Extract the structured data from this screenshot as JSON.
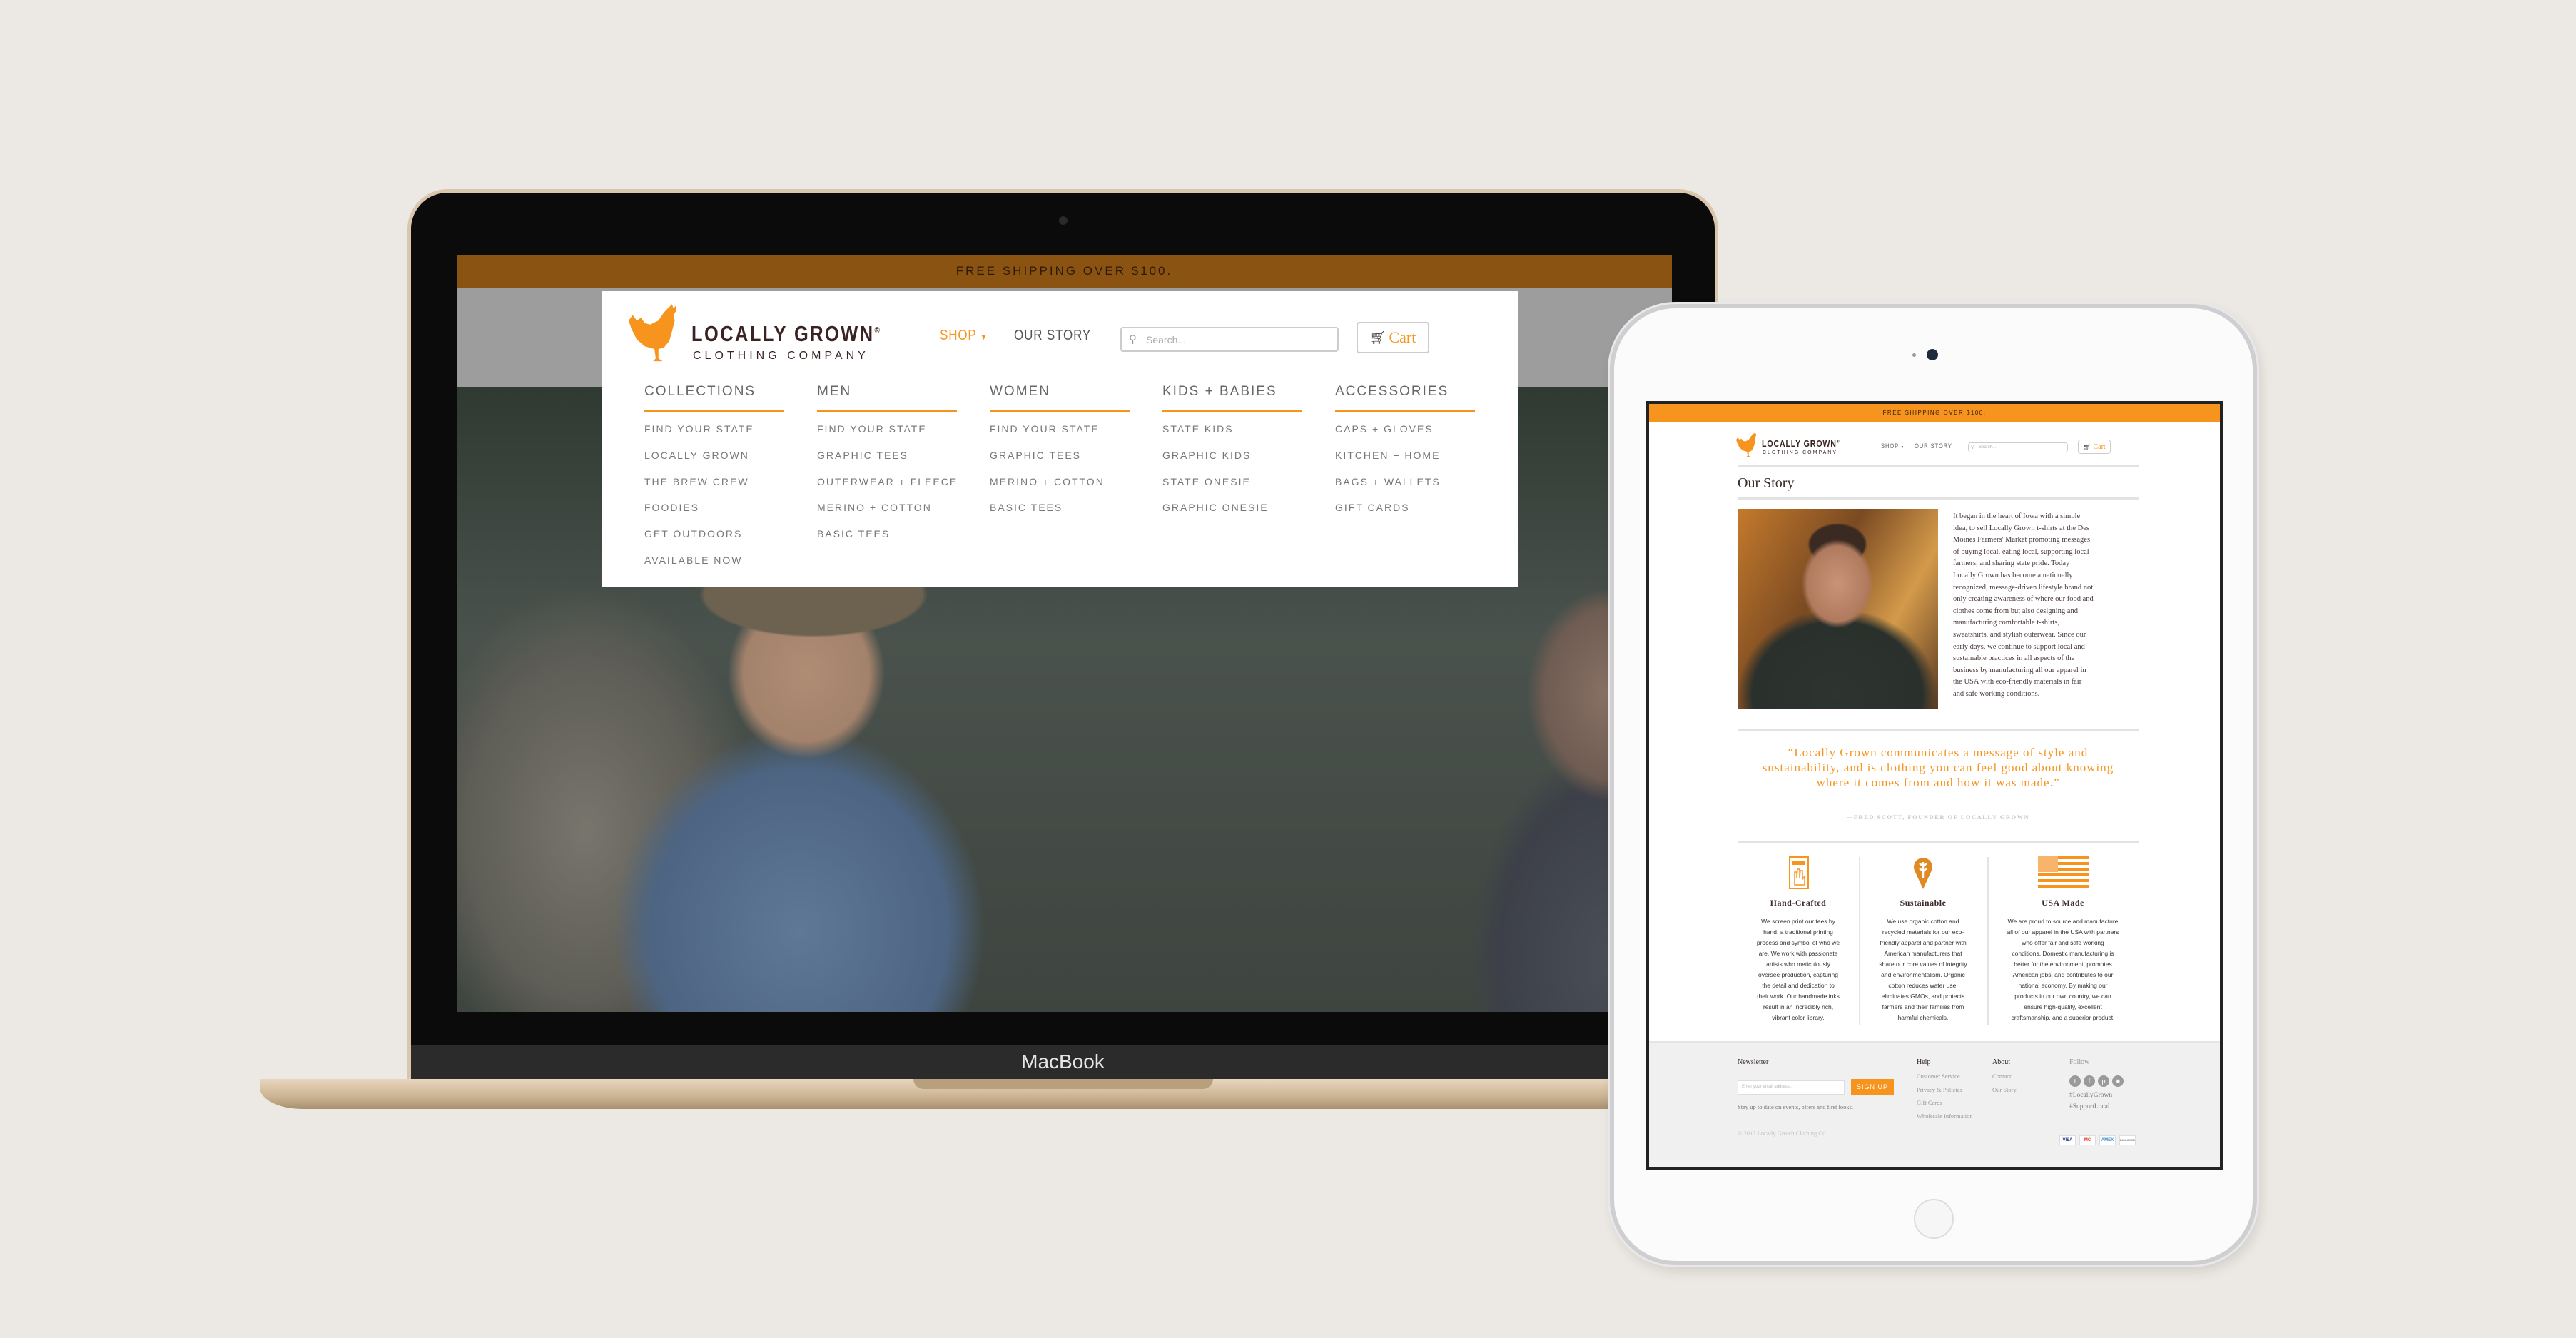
{
  "laptop": {
    "device_label": "MacBook",
    "promo": "FREE SHIPPING OVER $100.",
    "logo": {
      "name": "LOCALLY GROWN",
      "registered": "®",
      "tagline": "CLOTHING COMPANY"
    },
    "nav": {
      "shop": "SHOP",
      "our_story": "OUR STORY"
    },
    "search_placeholder": "Search...",
    "cart_label": "Cart",
    "mega_menu": [
      {
        "heading": "COLLECTIONS",
        "items": [
          "FIND YOUR STATE",
          "LOCALLY GROWN",
          "THE BREW CREW",
          "FOODIES",
          "GET OUTDOORS",
          "AVAILABLE NOW"
        ]
      },
      {
        "heading": "MEN",
        "items": [
          "FIND YOUR STATE",
          "GRAPHIC TEES",
          "OUTERWEAR + FLEECE",
          "MERINO + COTTON",
          "BASIC TEES"
        ]
      },
      {
        "heading": "WOMEN",
        "items": [
          "FIND YOUR STATE",
          "GRAPHIC TEES",
          "MERINO + COTTON",
          "BASIC TEES"
        ]
      },
      {
        "heading": "KIDS + BABIES",
        "items": [
          "STATE KIDS",
          "GRAPHIC KIDS",
          "STATE ONESIE",
          "GRAPHIC ONESIE"
        ]
      },
      {
        "heading": "ACCESSORIES",
        "items": [
          "CAPS + GLOVES",
          "KITCHEN + HOME",
          "BAGS + WALLETS",
          "GIFT CARDS"
        ]
      }
    ]
  },
  "tablet": {
    "promo": "FREE SHIPPING OVER $100.",
    "logo": {
      "name": "LOCALLY GROWN",
      "registered": "®",
      "tagline": "CLOTHING COMPANY"
    },
    "nav": {
      "shop": "SHOP",
      "our_story": "OUR STORY"
    },
    "search_placeholder": "Search...",
    "cart_label": "Cart",
    "page_title": "Our Story",
    "story_lines": [
      "It began in the heart of Iowa with a simple",
      "idea, to sell Locally Grown t-shirts at the Des",
      "Moines Farmers' Market promoting messages",
      "of buying local, eating local, supporting local",
      "farmers, and sharing state pride. Today",
      "Locally Grown has become a nationally",
      "recognized, message-driven lifestyle brand not",
      "only creating awareness of where our food and",
      "clothes come from but also designing and",
      "manufacturing comfortable t-shirts,",
      "sweatshirts, and stylish outerwear. Since our",
      "early days, we continue to support local and",
      "sustainable practices in all aspects of the",
      "business by manufacturing all our apparel in",
      "the USA with eco-friendly materials in fair",
      "and safe working conditions."
    ],
    "quote": "“Locally Grown communicates a message of style and sustainability, and is clothing you can feel good about knowing where it comes from and how it was made.”",
    "quote_attribution": "—FRED SCOTT, FOUNDER OF LOCALLY GROWN",
    "features": [
      {
        "icon": "hand-print-icon",
        "title": "Hand-Crafted",
        "lines": [
          "We screen print our tees by",
          "hand, a traditional printing",
          "process and symbol of who we",
          "are. We work with passionate",
          "artists who meticulously",
          "oversee production, capturing",
          "the detail and dedication to",
          "their work. Our handmade inks",
          "result in an incredibly rich,",
          "vibrant color library."
        ]
      },
      {
        "icon": "wheat-pin-icon",
        "title": "Sustainable",
        "lines": [
          "We use organic cotton and",
          "recycled materials for our eco-",
          "friendly apparel and partner with",
          "American manufacturers that",
          "share our core values of integrity",
          "and environmentalism. Organic",
          "cotton reduces water use,",
          "eliminates GMOs, and protects",
          "farmers and their families from",
          "harmful chemicals."
        ]
      },
      {
        "icon": "us-flag-icon",
        "title": "USA Made",
        "lines": [
          "We are proud to source and manufacture",
          "all of our apparel in the USA with partners",
          "who offer fair and safe working",
          "conditions. Domestic manufacturing is",
          "better for the environment, promotes",
          "American jobs, and contributes to our",
          "national economy. By making our",
          "products in our own country, we can",
          "ensure high-quality, excellent",
          "craftsmanship, and a superior product."
        ]
      }
    ],
    "footer": {
      "newsletter_title": "Newsletter",
      "email_placeholder": "Enter your email address...",
      "signup_label": "SIGN UP",
      "newsletter_note": "Stay up to date on events, offers and first looks.",
      "copyright": "© 2017 Locally Grown Clothing Co.",
      "help_title": "Help",
      "help_links": [
        "Customer Service",
        "Privacy & Policies",
        "Gift Cards",
        "Wholesale Information"
      ],
      "about_title": "About",
      "about_links": [
        "Contact",
        "Our Story"
      ],
      "follow_title": "Follow",
      "social_icons": [
        "twitter-icon",
        "facebook-icon",
        "pinterest-icon",
        "instagram-icon"
      ],
      "hashtags": [
        "#LocallyGrown",
        "#SupportLocal"
      ],
      "payment_icons": [
        "VISA",
        "MC",
        "AMEX",
        "DISCOVER"
      ]
    }
  },
  "colors": {
    "brand_orange": "#f7941d",
    "brand_brown": "#3a2323",
    "background": "#ece9e4"
  }
}
